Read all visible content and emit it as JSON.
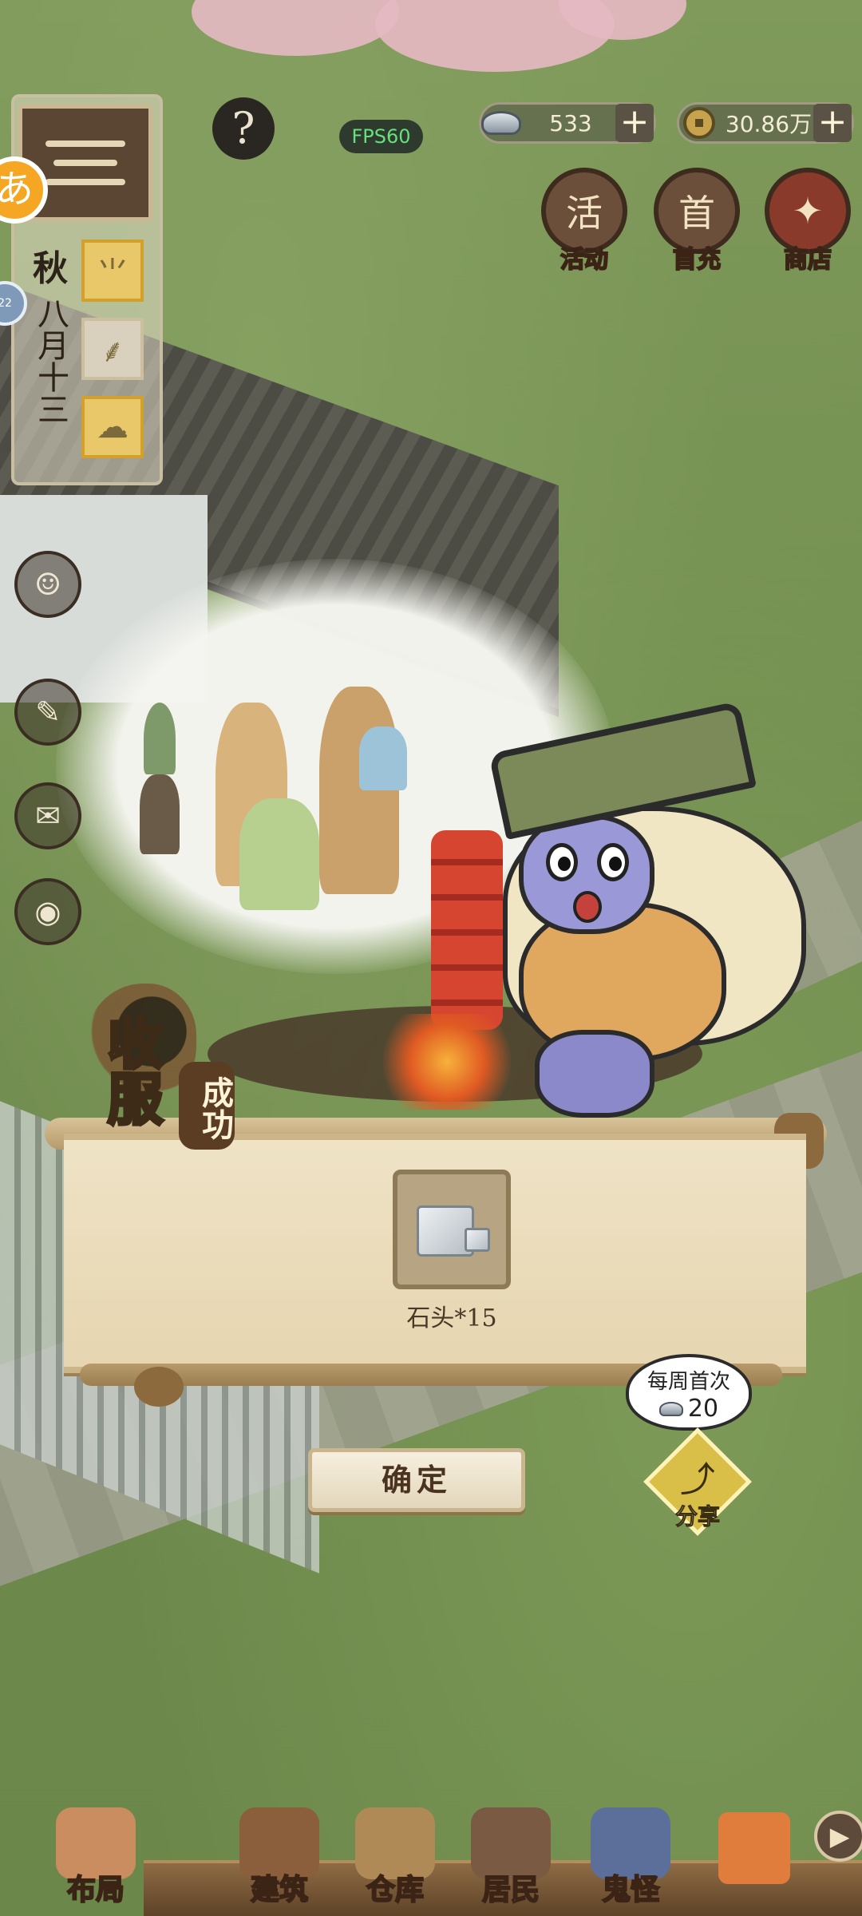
{
  "top_bar": {
    "fps": "FPS60",
    "help_icon": "?",
    "silver": {
      "icon": "silver-ingot-icon",
      "value": "533",
      "plus": "+"
    },
    "copper": {
      "icon": "copper-coin-icon",
      "value": "30.86万",
      "plus": "+"
    }
  },
  "calendar": {
    "season": "秋",
    "date": "八月十三",
    "weather_icons": [
      "rice-seedling-icon",
      "wheat-icon",
      "cloud-icon"
    ]
  },
  "top_icons": [
    {
      "label": "活动",
      "glyph": "活",
      "icon": "event-scroll-icon"
    },
    {
      "label": "首充",
      "glyph": "首",
      "icon": "first-recharge-bag-icon"
    },
    {
      "label": "商店",
      "glyph": "✦",
      "icon": "shop-ingot-icon"
    }
  ],
  "floating": {
    "orange_badge": "あ",
    "blue_badge": "22"
  },
  "result": {
    "title_big": "收服",
    "title_small": "成功",
    "reward_label": "石头*15",
    "confirm_label": "确定"
  },
  "share": {
    "bubble_title": "每周首次",
    "bubble_value": "20",
    "label": "分享",
    "icon": "share-icon"
  },
  "bottom_nav": [
    {
      "label": "布局",
      "icon": "layout-icon"
    },
    {
      "label": "建筑",
      "icon": "building-icon"
    },
    {
      "label": "仓库",
      "icon": "warehouse-icon"
    },
    {
      "label": "居民",
      "icon": "residents-icon"
    },
    {
      "label": "鬼怪",
      "icon": "ghost-icon"
    }
  ],
  "colors": {
    "grass": "#7f9a5b",
    "parchment": "#efe3c6",
    "wood": "#5a4632",
    "fps_text": "#66e07a",
    "share_gold": "#d9bf47"
  }
}
